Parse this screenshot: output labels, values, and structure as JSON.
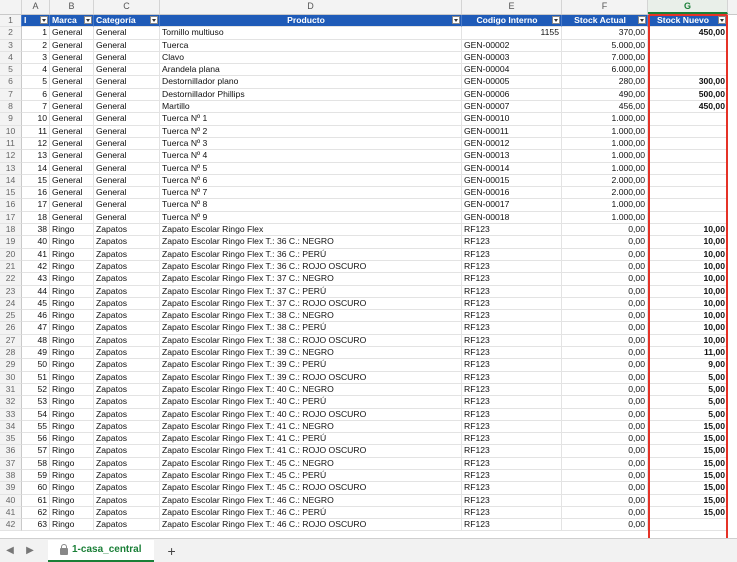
{
  "columns": [
    "A",
    "B",
    "C",
    "D",
    "E",
    "F",
    "G"
  ],
  "selected_column": "G",
  "header": {
    "A": "I",
    "B": "Marca",
    "C": "Categoría",
    "D": "Producto",
    "E": "Codigo Interno",
    "F": "Stock Actual",
    "G": "Stock Nuevo"
  },
  "rows": [
    {
      "r": "2",
      "a": "1",
      "b": "General",
      "c": "General",
      "d": "Tornillo multiuso",
      "e": "1155",
      "f": "370,00",
      "g": "450,00"
    },
    {
      "r": "3",
      "a": "2",
      "b": "General",
      "c": "General",
      "d": "Tuerca",
      "e": "GEN-00002",
      "f": "5.000,00",
      "g": ""
    },
    {
      "r": "4",
      "a": "3",
      "b": "General",
      "c": "General",
      "d": "Clavo",
      "e": "GEN-00003",
      "f": "7.000,00",
      "g": ""
    },
    {
      "r": "5",
      "a": "4",
      "b": "General",
      "c": "General",
      "d": "Arandela plana",
      "e": "GEN-00004",
      "f": "6.000,00",
      "g": ""
    },
    {
      "r": "6",
      "a": "5",
      "b": "General",
      "c": "General",
      "d": "Destornillador plano",
      "e": "GEN-00005",
      "f": "280,00",
      "g": "300,00"
    },
    {
      "r": "7",
      "a": "6",
      "b": "General",
      "c": "General",
      "d": "Destornillador Phillips",
      "e": "GEN-00006",
      "f": "490,00",
      "g": "500,00"
    },
    {
      "r": "8",
      "a": "7",
      "b": "General",
      "c": "General",
      "d": "Martillo",
      "e": "GEN-00007",
      "f": "456,00",
      "g": "450,00"
    },
    {
      "r": "9",
      "a": "10",
      "b": "General",
      "c": "General",
      "d": "Tuerca Nº 1",
      "e": "GEN-00010",
      "f": "1.000,00",
      "g": ""
    },
    {
      "r": "10",
      "a": "11",
      "b": "General",
      "c": "General",
      "d": "Tuerca Nº 2",
      "e": "GEN-00011",
      "f": "1.000,00",
      "g": ""
    },
    {
      "r": "11",
      "a": "12",
      "b": "General",
      "c": "General",
      "d": "Tuerca Nº 3",
      "e": "GEN-00012",
      "f": "1.000,00",
      "g": ""
    },
    {
      "r": "12",
      "a": "13",
      "b": "General",
      "c": "General",
      "d": "Tuerca Nº 4",
      "e": "GEN-00013",
      "f": "1.000,00",
      "g": ""
    },
    {
      "r": "13",
      "a": "14",
      "b": "General",
      "c": "General",
      "d": "Tuerca Nº 5",
      "e": "GEN-00014",
      "f": "1.000,00",
      "g": ""
    },
    {
      "r": "14",
      "a": "15",
      "b": "General",
      "c": "General",
      "d": "Tuerca Nº 6",
      "e": "GEN-00015",
      "f": "2.000,00",
      "g": ""
    },
    {
      "r": "15",
      "a": "16",
      "b": "General",
      "c": "General",
      "d": "Tuerca Nº 7",
      "e": "GEN-00016",
      "f": "2.000,00",
      "g": ""
    },
    {
      "r": "16",
      "a": "17",
      "b": "General",
      "c": "General",
      "d": "Tuerca Nº 8",
      "e": "GEN-00017",
      "f": "1.000,00",
      "g": ""
    },
    {
      "r": "17",
      "a": "18",
      "b": "General",
      "c": "General",
      "d": "Tuerca Nº 9",
      "e": "GEN-00018",
      "f": "1.000,00",
      "g": ""
    },
    {
      "r": "18",
      "a": "38",
      "b": "Ringo",
      "c": "Zapatos",
      "d": "Zapato Escolar Ringo Flex",
      "e": "RF123",
      "f": "0,00",
      "g": "10,00"
    },
    {
      "r": "19",
      "a": "40",
      "b": "Ringo",
      "c": "Zapatos",
      "d": "Zapato Escolar Ringo Flex  T.: 36 C.: NEGRO",
      "e": "RF123",
      "f": "0,00",
      "g": "10,00"
    },
    {
      "r": "20",
      "a": "41",
      "b": "Ringo",
      "c": "Zapatos",
      "d": "Zapato Escolar Ringo Flex  T.: 36 C.: PERÚ",
      "e": "RF123",
      "f": "0,00",
      "g": "10,00"
    },
    {
      "r": "21",
      "a": "42",
      "b": "Ringo",
      "c": "Zapatos",
      "d": "Zapato Escolar Ringo Flex  T.: 36 C.: ROJO OSCURO",
      "e": "RF123",
      "f": "0,00",
      "g": "10,00"
    },
    {
      "r": "22",
      "a": "43",
      "b": "Ringo",
      "c": "Zapatos",
      "d": "Zapato Escolar Ringo Flex  T.: 37 C.: NEGRO",
      "e": "RF123",
      "f": "0,00",
      "g": "10,00"
    },
    {
      "r": "23",
      "a": "44",
      "b": "Ringo",
      "c": "Zapatos",
      "d": "Zapato Escolar Ringo Flex  T.: 37 C.: PERÚ",
      "e": "RF123",
      "f": "0,00",
      "g": "10,00"
    },
    {
      "r": "24",
      "a": "45",
      "b": "Ringo",
      "c": "Zapatos",
      "d": "Zapato Escolar Ringo Flex  T.: 37 C.: ROJO OSCURO",
      "e": "RF123",
      "f": "0,00",
      "g": "10,00"
    },
    {
      "r": "25",
      "a": "46",
      "b": "Ringo",
      "c": "Zapatos",
      "d": "Zapato Escolar Ringo Flex  T.: 38 C.: NEGRO",
      "e": "RF123",
      "f": "0,00",
      "g": "10,00"
    },
    {
      "r": "26",
      "a": "47",
      "b": "Ringo",
      "c": "Zapatos",
      "d": "Zapato Escolar Ringo Flex  T.: 38 C.: PERÚ",
      "e": "RF123",
      "f": "0,00",
      "g": "10,00"
    },
    {
      "r": "27",
      "a": "48",
      "b": "Ringo",
      "c": "Zapatos",
      "d": "Zapato Escolar Ringo Flex  T.: 38 C.: ROJO OSCURO",
      "e": "RF123",
      "f": "0,00",
      "g": "10,00"
    },
    {
      "r": "28",
      "a": "49",
      "b": "Ringo",
      "c": "Zapatos",
      "d": "Zapato Escolar Ringo Flex  T.: 39 C.: NEGRO",
      "e": "RF123",
      "f": "0,00",
      "g": "11,00"
    },
    {
      "r": "29",
      "a": "50",
      "b": "Ringo",
      "c": "Zapatos",
      "d": "Zapato Escolar Ringo Flex  T.: 39 C.: PERÚ",
      "e": "RF123",
      "f": "0,00",
      "g": "9,00"
    },
    {
      "r": "30",
      "a": "51",
      "b": "Ringo",
      "c": "Zapatos",
      "d": "Zapato Escolar Ringo Flex  T.: 39 C.: ROJO OSCURO",
      "e": "RF123",
      "f": "0,00",
      "g": "5,00"
    },
    {
      "r": "31",
      "a": "52",
      "b": "Ringo",
      "c": "Zapatos",
      "d": "Zapato Escolar Ringo Flex  T.: 40 C.: NEGRO",
      "e": "RF123",
      "f": "0,00",
      "g": "5,00"
    },
    {
      "r": "32",
      "a": "53",
      "b": "Ringo",
      "c": "Zapatos",
      "d": "Zapato Escolar Ringo Flex  T.: 40 C.: PERÚ",
      "e": "RF123",
      "f": "0,00",
      "g": "5,00"
    },
    {
      "r": "33",
      "a": "54",
      "b": "Ringo",
      "c": "Zapatos",
      "d": "Zapato Escolar Ringo Flex  T.: 40 C.: ROJO OSCURO",
      "e": "RF123",
      "f": "0,00",
      "g": "5,00"
    },
    {
      "r": "34",
      "a": "55",
      "b": "Ringo",
      "c": "Zapatos",
      "d": "Zapato Escolar Ringo Flex  T.: 41 C.: NEGRO",
      "e": "RF123",
      "f": "0,00",
      "g": "15,00"
    },
    {
      "r": "35",
      "a": "56",
      "b": "Ringo",
      "c": "Zapatos",
      "d": "Zapato Escolar Ringo Flex  T.: 41 C.: PERÚ",
      "e": "RF123",
      "f": "0,00",
      "g": "15,00"
    },
    {
      "r": "36",
      "a": "57",
      "b": "Ringo",
      "c": "Zapatos",
      "d": "Zapato Escolar Ringo Flex  T.: 41 C.: ROJO OSCURO",
      "e": "RF123",
      "f": "0,00",
      "g": "15,00"
    },
    {
      "r": "37",
      "a": "58",
      "b": "Ringo",
      "c": "Zapatos",
      "d": "Zapato Escolar Ringo Flex  T.: 45 C.: NEGRO",
      "e": "RF123",
      "f": "0,00",
      "g": "15,00"
    },
    {
      "r": "38",
      "a": "59",
      "b": "Ringo",
      "c": "Zapatos",
      "d": "Zapato Escolar Ringo Flex  T.: 45 C.: PERÚ",
      "e": "RF123",
      "f": "0,00",
      "g": "15,00"
    },
    {
      "r": "39",
      "a": "60",
      "b": "Ringo",
      "c": "Zapatos",
      "d": "Zapato Escolar Ringo Flex  T.: 45 C.: ROJO OSCURO",
      "e": "RF123",
      "f": "0,00",
      "g": "15,00"
    },
    {
      "r": "40",
      "a": "61",
      "b": "Ringo",
      "c": "Zapatos",
      "d": "Zapato Escolar Ringo Flex  T.: 46 C.: NEGRO",
      "e": "RF123",
      "f": "0,00",
      "g": "15,00"
    },
    {
      "r": "41",
      "a": "62",
      "b": "Ringo",
      "c": "Zapatos",
      "d": "Zapato Escolar Ringo Flex  T.: 46 C.: PERÚ",
      "e": "RF123",
      "f": "0,00",
      "g": "15,00"
    },
    {
      "r": "42",
      "a": "63",
      "b": "Ringo",
      "c": "Zapatos",
      "d": "Zapato Escolar Ringo Flex  T.: 46 C.: ROJO OSCURO",
      "e": "RF123",
      "f": "0,00",
      "g": ""
    }
  ],
  "sheet_tab": {
    "label": "1-casa_central",
    "icon": "lock-icon"
  },
  "add_sheet_label": "+",
  "nav": {
    "prev": "◀",
    "next": "▶"
  },
  "colors": {
    "header_bg": "#1f5bb8",
    "highlight_border": "#e53227",
    "active_tab": "#1a7f37"
  }
}
